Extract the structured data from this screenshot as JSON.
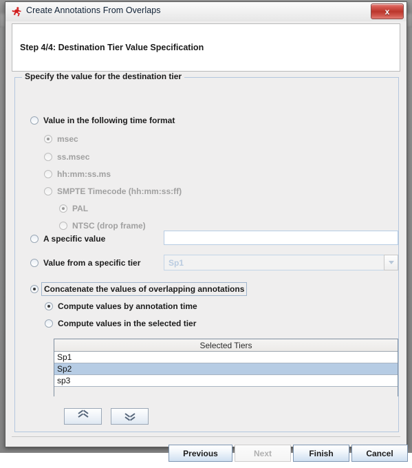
{
  "window": {
    "title": "Create Annotations From Overlaps",
    "app_icon": "elan-runner-icon",
    "close_label": "x"
  },
  "step": {
    "title": "Step 4/4: Destination Tier Value Specification"
  },
  "group": {
    "legend": "Specify the value for the destination tier"
  },
  "options": {
    "time_format": {
      "label": "Value in the following time format",
      "selected": false,
      "enabled": true,
      "sub_options": [
        {
          "label": "msec",
          "selected": true,
          "enabled": false
        },
        {
          "label": "ss.msec",
          "selected": false,
          "enabled": false
        },
        {
          "label": "hh:mm:ss.ms",
          "selected": false,
          "enabled": false
        },
        {
          "label": "SMPTE Timecode (hh:mm:ss:ff)",
          "selected": false,
          "enabled": false
        }
      ],
      "smpte_options": [
        {
          "label": "PAL",
          "selected": true,
          "enabled": false
        },
        {
          "label": "NTSC (drop frame)",
          "selected": false,
          "enabled": false
        }
      ]
    },
    "specific_value": {
      "label": "A specific value",
      "selected": false,
      "input_value": "",
      "input_placeholder": ""
    },
    "value_from_tier": {
      "label": "Value from a specific tier",
      "selected": false,
      "combo_selected": "Sp1",
      "combo_enabled": false,
      "combo_icon": "chevron-down-icon"
    },
    "concatenate": {
      "label": "Concatenate the values of overlapping annotations",
      "selected": true,
      "focused": true,
      "sub_options": [
        {
          "label": "Compute values by annotation time",
          "selected": true
        },
        {
          "label": "Compute values in the selected tier",
          "selected": false
        }
      ]
    }
  },
  "tiers_table": {
    "header": "Selected Tiers",
    "rows": [
      {
        "name": "Sp1",
        "selected": false
      },
      {
        "name": "Sp2",
        "selected": true
      },
      {
        "name": "sp3",
        "selected": false
      }
    ]
  },
  "reorder": {
    "up_icon": "double-chevron-up-icon",
    "down_icon": "double-chevron-down-icon"
  },
  "footer": {
    "previous": "Previous",
    "next": "Next",
    "finish": "Finish",
    "cancel": "Cancel",
    "next_enabled": false
  },
  "colors": {
    "dialog_bg": "#efeeee",
    "panel_border": "#b3c6de",
    "selected_row": "#b6cce4",
    "close_red": "#bb362c",
    "disabled_text": "#a0a0a0"
  }
}
